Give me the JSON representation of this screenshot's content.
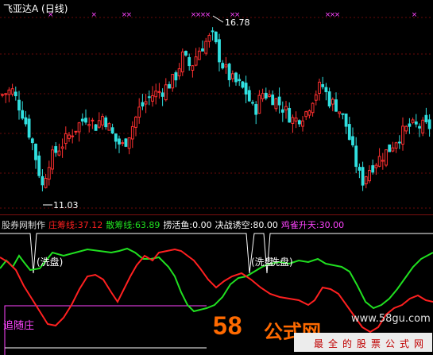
{
  "title": "飞亚达A (日线)",
  "price_panel": {
    "high_label": "16.78",
    "low_label": "11.03",
    "y_range": [
      10.6,
      17.6
    ],
    "candle_up_color": "#ff3030",
    "candle_down_color": "#30e0e0",
    "marker_color": "#ff44ff",
    "markers": [
      {
        "x": 0.11,
        "n": 1
      },
      {
        "x": 0.21,
        "n": 1
      },
      {
        "x": 0.28,
        "n": 2
      },
      {
        "x": 0.44,
        "n": 4
      },
      {
        "x": 0.53,
        "n": 2
      },
      {
        "x": 0.75,
        "n": 3
      },
      {
        "x": 0.95,
        "n": 1
      }
    ]
  },
  "indicator": {
    "author": "股券网制作",
    "zhuang_label": "庄筹线:",
    "zhuang_value": "37.12",
    "san_label": "散筹线:",
    "san_value": "63.89",
    "laohuoyu_label": "捞活鱼:",
    "laohuoyu_value": "0.00",
    "juezhan_label": "决战诱空:",
    "juezhan_value": "80.00",
    "quezhan_label": "鸡雀升天:",
    "quezhan_value": "30.00",
    "xipan_1": "(洗盘)",
    "xipan_2": "(洗盘",
    "xipan_3": "洗盘)",
    "zhuisuizhuang": "追随庄",
    "colors": {
      "zhuang": "#ff2020",
      "san": "#20e020",
      "laohuoyu": "#ffffff",
      "juezhan": "#ffffff",
      "quezhan": "#ff44ff",
      "author": "#dddddd"
    }
  },
  "watermark": {
    "num": "58",
    "word": "公式网",
    "url": "www.58gu.com",
    "slogan": "最全的股票公式网"
  }
}
